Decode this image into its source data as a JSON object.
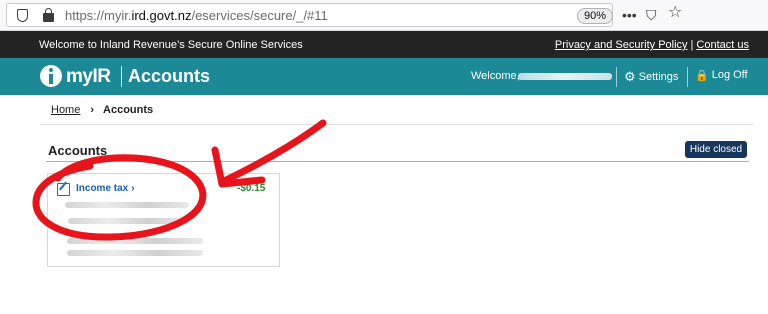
{
  "browser": {
    "url_prefix": "https://myir.",
    "url_domain": "ird.govt.nz",
    "url_path": "/eservices/secure/_/#11",
    "zoom": "90%",
    "icons": [
      "shield-icon",
      "lock-icon",
      "more-icon",
      "pocket-icon",
      "bookmark-star-icon"
    ],
    "more_glyph": "•••",
    "pocket_glyph": "⛉",
    "star_glyph": "☆"
  },
  "topbar": {
    "welcome_text": "Welcome to Inland Revenue’s Secure Online Services",
    "privacy_link": "Privacy and Security Policy",
    "separator": "|",
    "contact_link": "Contact us"
  },
  "header": {
    "logo_text": "myIR",
    "page_title": "Accounts",
    "welcome_label": "Welcome,",
    "settings_label": "Settings",
    "settings_glyph": "⚙",
    "logoff_label": "Log Off",
    "logoff_glyph": "🔒",
    "accent_color": "#1b8a96"
  },
  "breadcrumb": {
    "home": "Home",
    "chevron": "›",
    "current": "Accounts"
  },
  "accounts": {
    "section_title": "Accounts",
    "hide_closed_label": "Hide closed",
    "cards": [
      {
        "label": "Income tax",
        "arrow": "›",
        "amount": "-$0.15",
        "amount_color": "#2c8a2c"
      }
    ]
  },
  "annotation": {
    "color": "#e8141b"
  }
}
